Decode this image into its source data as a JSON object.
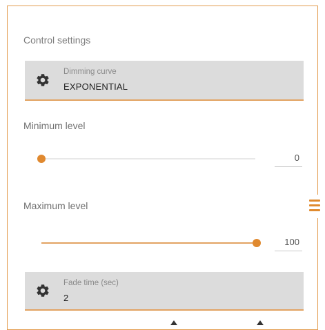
{
  "panel": {
    "section_title": "Control settings",
    "dimming_curve": {
      "label": "Dimming curve",
      "value": "EXPONENTIAL",
      "icon": "gear-icon"
    },
    "minimum_level": {
      "label": "Minimum level",
      "value": "0",
      "fraction": 0.0
    },
    "maximum_level": {
      "label": "Maximum level",
      "value": "100",
      "fraction": 1.0
    },
    "fade_time": {
      "label": "Fade time (sec)",
      "value": "2",
      "icon": "gear-icon"
    }
  },
  "menu_tab": {
    "icon": "hamburger-menu-icon"
  },
  "colors": {
    "accent": "#e08a2e",
    "field_bg": "#dcdcdc",
    "border": "#e29a4a"
  }
}
